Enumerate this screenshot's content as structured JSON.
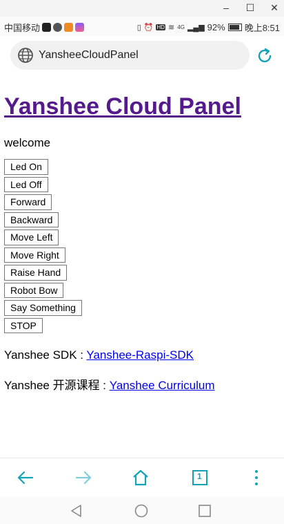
{
  "window": {
    "minimize": "–",
    "maximize": "☐",
    "close": "✕"
  },
  "status": {
    "carrier": "中国移动",
    "battery_percent": "92%",
    "time": "晚上8:51",
    "network": "4G",
    "battery_level": 0.92
  },
  "browser": {
    "url": "YansheeCloudPanel"
  },
  "page": {
    "title": "Yanshee Cloud Panel",
    "welcome": "welcome",
    "buttons": [
      "Led On",
      "Led Off",
      "Forward",
      "Backward",
      "Move Left",
      "Move Right",
      "Raise Hand",
      "Robot Bow",
      "Say Something",
      "STOP"
    ],
    "sdk_label": "Yanshee SDK : ",
    "sdk_link": "Yanshee-Raspi-SDK",
    "course_label": "Yanshee 开源课程 : ",
    "course_link": "Yanshee Curriculum"
  },
  "bottom_nav": {
    "tab_count": "1"
  },
  "colors": {
    "accent": "#13a3b8",
    "visited_link": "#551a8b",
    "link": "#0000ee"
  }
}
